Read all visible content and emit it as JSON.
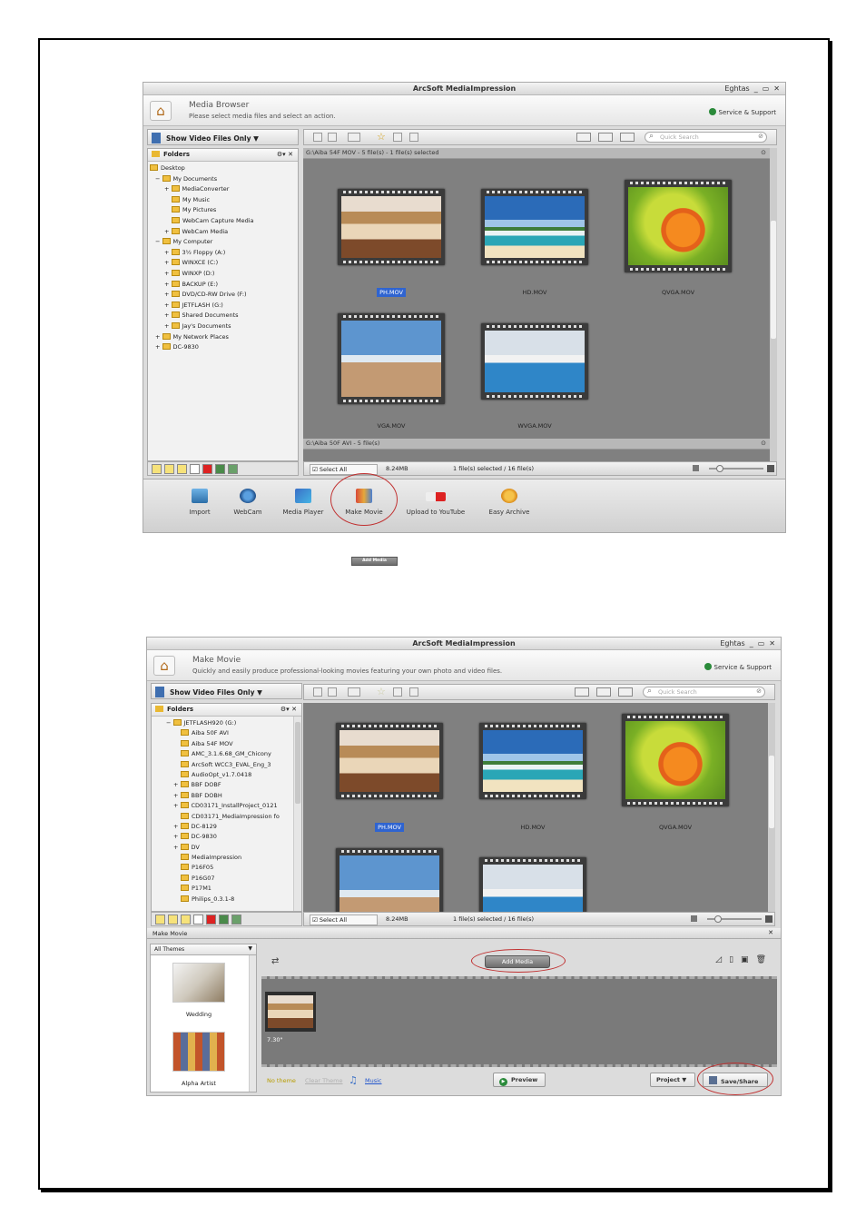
{
  "screenshot1": {
    "window_title": "ArcSoft MediaImpression",
    "user": "Eghtas",
    "header_title": "Media Browser",
    "header_subtitle": "Please select media files and select an action.",
    "service_support": "Service & Support",
    "show_files": "Show Video Files Only",
    "folders_label": "Folders",
    "quick_search_placeholder": "Quick Search",
    "tree": [
      "Desktop",
      "My Documents",
      "MediaConverter",
      "My Music",
      "My Pictures",
      "WebCam Capture Media",
      "WebCam Media",
      "My Computer",
      "3½ Floppy (A:)",
      "WINXCE (C:)",
      "WINXP (D:)",
      "BACKUP (E:)",
      "DVD/CD-RW Drive (F:)",
      "JETFLASH (G:)",
      "Shared Documents",
      "Jay's Documents",
      "My Network Places",
      "DC-9830"
    ],
    "group1_header": "G:\\Aiba 54F MOV - 5 file(s)    - 1 file(s) selected",
    "group2_header": "G:\\Aiba 50F AVI - 5 file(s)",
    "thumbs": [
      {
        "name": "PH.MOV",
        "selected": true
      },
      {
        "name": "HD.MOV"
      },
      {
        "name": "QVGA.MOV"
      },
      {
        "name": "VGA.MOV"
      },
      {
        "name": "WVGA.MOV"
      }
    ],
    "select_all": "Select All",
    "size": "8.24MB",
    "selected_status": "1 file(s) selected / 16 file(s)",
    "actions": [
      "Import",
      "WebCam",
      "Media Player",
      "Make Movie",
      "Upload to YouTube",
      "Easy Archive"
    ]
  },
  "inline_icon_label": "Add Media",
  "screenshot2": {
    "window_title": "ArcSoft MediaImpression",
    "user": "Eghtas",
    "header_title": "Make Movie",
    "header_subtitle": "Quickly and easily produce professional-looking movies featuring your own photo and video files.",
    "service_support": "Service & Support",
    "show_files": "Show Video Files Only",
    "folders_label": "Folders",
    "quick_search_placeholder": "Quick Search",
    "tree": [
      "JETFLASH920 (G:)",
      "Aiba 50F AVI",
      "Aiba 54F MOV",
      "AMC_3.1.6.68_GM_Chicony",
      "ArcSoft WCC3_EVAL_Eng_3",
      "AudioOpt_v1.7.0418",
      "BBF DOBF",
      "BBF DOBH",
      "CD03171_InstallProject_0121",
      "CD03171_MediaImpression fo",
      "DC-8129",
      "DC-9830",
      "DV",
      "MediaImpression",
      "P16F05",
      "P16G07",
      "P17M1",
      "Philips_0.3.1-8"
    ],
    "thumbs": [
      {
        "name": "PH.MOV",
        "selected": true
      },
      {
        "name": "HD.MOV"
      },
      {
        "name": "QVGA.MOV"
      }
    ],
    "select_all": "Select All",
    "size": "8.24MB",
    "selected_status": "1 file(s) selected / 16 file(s)",
    "make_movie_label": "Make Movie",
    "all_themes": "All Themes",
    "themes": [
      "Wedding",
      "Alpha Artist"
    ],
    "add_media": "Add Media",
    "clip_duration": "7.30\"",
    "no_theme": "No theme",
    "clear_theme": "Clear Theme",
    "music": "Music",
    "preview": "Preview",
    "project": "Project",
    "save_share": "Save/Share"
  }
}
